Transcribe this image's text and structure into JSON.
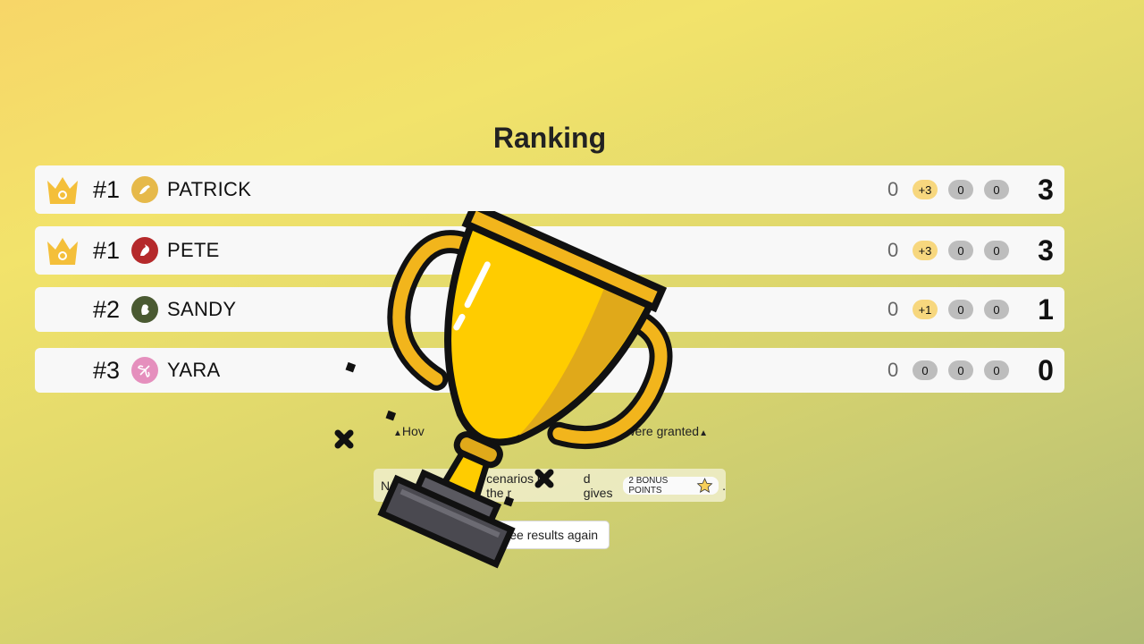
{
  "title": "Ranking",
  "players": [
    {
      "rank": "#1",
      "name": "PATRICK",
      "base": "0",
      "pills": [
        "+3",
        "0",
        "0"
      ],
      "pill_styles": [
        "gold",
        "grey",
        "grey"
      ],
      "total": "3",
      "crown": true,
      "avatar_color": "#e6b94a",
      "avatar_icon": "bird-icon"
    },
    {
      "rank": "#1",
      "name": "PETE",
      "base": "0",
      "pills": [
        "+3",
        "0",
        "0"
      ],
      "pill_styles": [
        "gold",
        "grey",
        "grey"
      ],
      "total": "3",
      "crown": true,
      "avatar_color": "#b5292b",
      "avatar_icon": "cardinal-icon"
    },
    {
      "rank": "#2",
      "name": "SANDY",
      "base": "0",
      "pills": [
        "+1",
        "0",
        "0"
      ],
      "pill_styles": [
        "gold",
        "grey",
        "grey"
      ],
      "total": "1",
      "crown": false,
      "avatar_color": "#4a5a32",
      "avatar_icon": "beaver-icon"
    },
    {
      "rank": "#3",
      "name": "YARA",
      "base": "0",
      "pills": [
        "0",
        "0",
        "0"
      ],
      "pill_styles": [
        "grey",
        "grey",
        "grey"
      ],
      "total": "0",
      "crown": false,
      "avatar_color": "#e58fbd",
      "avatar_icon": "dragonfly-icon"
    }
  ],
  "hint": {
    "left": "Hov",
    "right": "ey were granted"
  },
  "bonus": {
    "text": "N",
    "text2": "cenarios in the r",
    "text3": "d gives",
    "chip": "2 BONUS POINTS",
    "end": "."
  },
  "again_button": "See results again",
  "colors": {
    "crown": "#f4bf3a",
    "trophy": "#ffcc00",
    "trophy_outline": "#111111",
    "trophy_base": "#4a4950"
  }
}
